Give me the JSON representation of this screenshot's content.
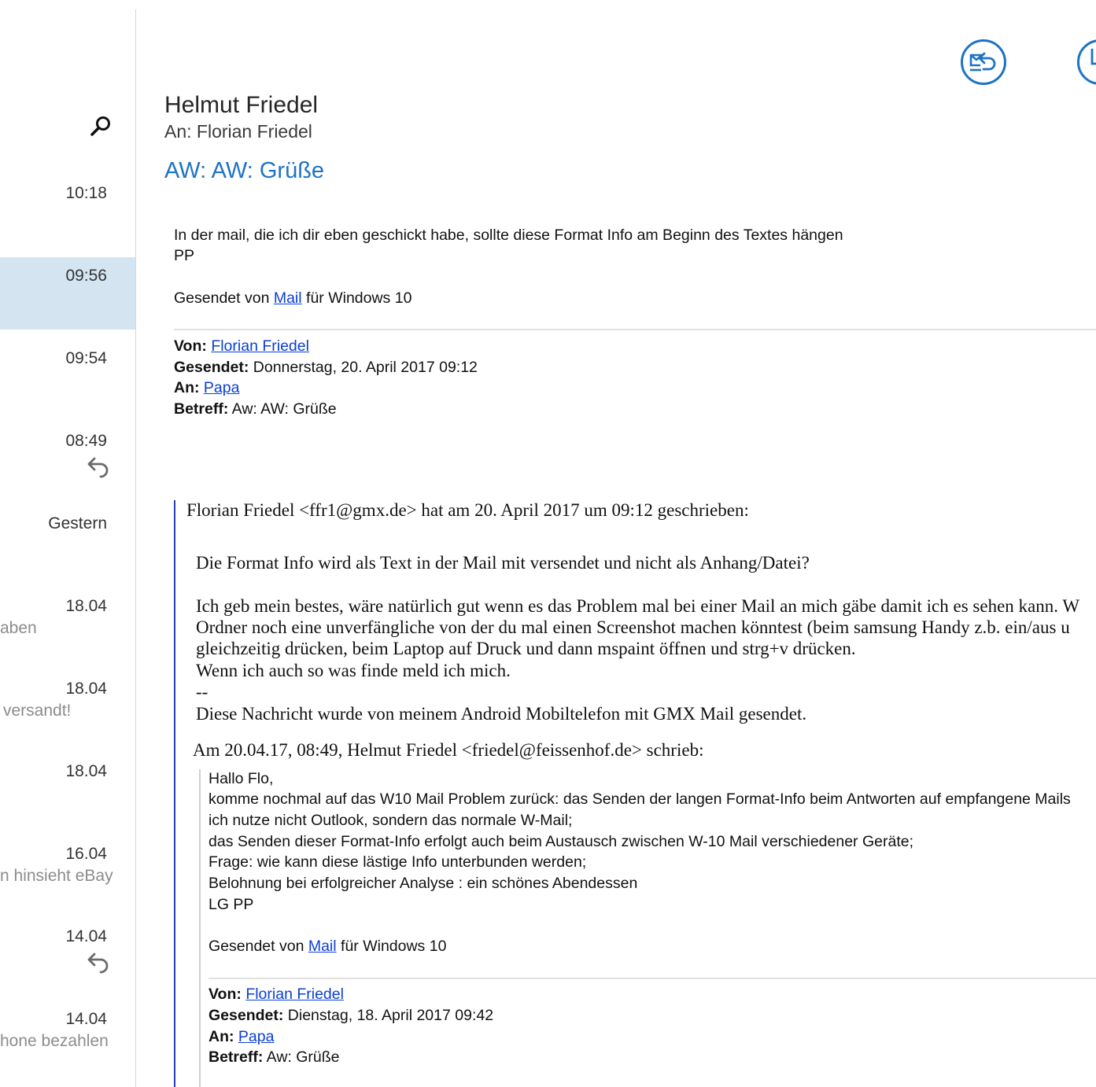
{
  "list": {
    "items": [
      {
        "time": "10:18",
        "preview": ""
      },
      {
        "time": "09:56",
        "preview": ""
      },
      {
        "time": "09:54",
        "preview": ""
      },
      {
        "time": "08:49",
        "preview": ""
      },
      {
        "time": "Gestern",
        "preview": ""
      },
      {
        "time": "18.04",
        "preview": "aben"
      },
      {
        "time": "18.04",
        "preview": "versandt!"
      },
      {
        "time": "18.04",
        "preview": ""
      },
      {
        "time": "16.04",
        "preview": "n hinsieht eBay"
      },
      {
        "time": "14.04",
        "preview": ""
      },
      {
        "time": "14.04",
        "preview": "hone bezahlen"
      }
    ]
  },
  "message": {
    "sender": "Helmut Friedel",
    "recipient_line": "An: Florian Friedel",
    "subject": "AW: AW: Grüße",
    "body": {
      "line1": "In der mail, die ich dir eben geschickt habe, sollte diese Format Info am Beginn des Textes hängen",
      "line2": "PP",
      "sent_prefix": "Gesendet von ",
      "sent_link": "Mail",
      "sent_suffix": " für Windows 10"
    },
    "header1": {
      "from_label": "Von:",
      "from": "Florian Friedel",
      "sent_label": "Gesendet:",
      "sent": " Donnerstag, 20. April 2017 09:12",
      "to_label": "An:",
      "to": "Papa",
      "subject_label": "Betreff:",
      "subject": " Aw: AW: Grüße"
    },
    "quote1": {
      "intro": "Florian Friedel <ffr1@gmx.de> hat am 20. April 2017 um 09:12 geschrieben:",
      "q1": "Die Format Info wird als Text in der Mail mit versendet und nicht als Anhang/Datei?",
      "p1": "Ich geb mein bestes, wäre natürlich gut wenn es das Problem mal bei einer Mail an mich gäbe damit ich es sehen kann. W",
      "p2": "Ordner noch eine unverfängliche von der du mal einen Screenshot machen könntest (beim samsung Handy z.b. ein/aus u",
      "p3": "gleichzeitig drücken, beim Laptop auf Druck und dann mspaint öffnen und strg+v drücken.",
      "p4": "Wenn ich auch so was finde meld ich mich.",
      "sig_sep": "--",
      "sig": "Diese Nachricht wurde von meinem Android Mobiltelefon mit GMX Mail gesendet."
    },
    "quote2": {
      "intro": "Am 20.04.17, 08:49, Helmut Friedel <friedel@feissenhof.de> schrieb:",
      "l1": "Hallo Flo,",
      "l2": "komme nochmal auf das W10 Mail Problem zurück: das Senden der langen Format-Info beim Antworten auf empfangene Mails",
      "l3": "ich nutze nicht Outlook, sondern das normale W-Mail;",
      "l4": "das Senden dieser Format-Info erfolgt auch beim Austausch zwischen W-10 Mail verschiedener Geräte;",
      "l5": "Frage: wie kann diese lästige Info unterbunden werden;",
      "l6": "Belohnung bei erfolgreicher Analyse : ein schönes Abendessen",
      "l7": "LG PP",
      "sent_prefix": "Gesendet von ",
      "sent_link": "Mail",
      "sent_suffix": " für Windows 10"
    },
    "header2": {
      "from_label": "Von:",
      "from": "Florian Friedel",
      "sent_label": "Gesendet:",
      "sent": " Dienstag, 18. April 2017 09:42",
      "to_label": "An:",
      "to": "Papa",
      "subject_label": "Betreff:",
      "subject": " Aw: Grüße"
    }
  },
  "colors": {
    "accent": "#1e73c4",
    "selected": "#d4e4f1",
    "link": "#0a3fd6",
    "quote_bar": "#2a3bb8"
  },
  "icons": {
    "search": "search-icon",
    "reply": "reply-icon",
    "reply_all": "reply-all-icon",
    "forward": "forward-icon"
  }
}
